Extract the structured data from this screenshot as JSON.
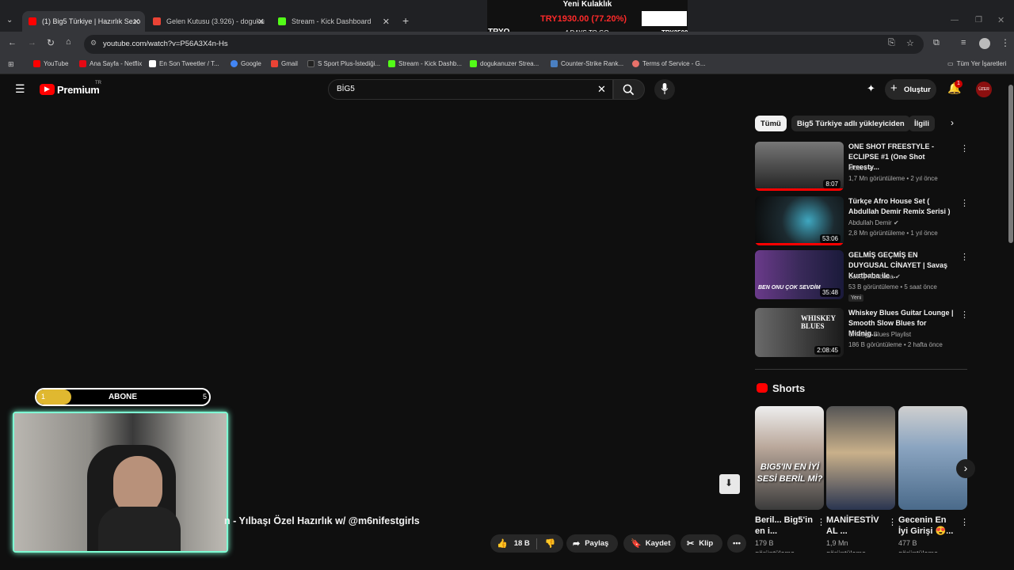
{
  "browser": {
    "tabs": [
      {
        "label": "(1) Big5 Türkiye | Hazırlık Sezonu",
        "favicon_color": "#ff0000",
        "active": true
      },
      {
        "label": "Gelen Kutusu (3.926) - dogukan",
        "favicon_color": "#ea4335",
        "active": false
      },
      {
        "label": "Stream - Kick Dashboard",
        "favicon_color": "#53fc18",
        "active": false
      }
    ],
    "new_tab": "+",
    "url": "youtube.com/watch?v=P56A3X4n-Hs",
    "bookmarks": [
      {
        "label": "YouTube",
        "color": "#ff0000"
      },
      {
        "label": "Ana Sayfa - Netflix",
        "color": "#e50914"
      },
      {
        "label": "En Son Tweetler / T...",
        "color": "#ffffff"
      },
      {
        "label": "Google",
        "color": "#4285f4"
      },
      {
        "label": "Gmail",
        "color": "#ea4335"
      },
      {
        "label": "S Sport Plus-İstediği...",
        "color": "#222222"
      },
      {
        "label": "Stream - Kick Dashb...",
        "color": "#53fc18"
      },
      {
        "label": "dogukanuzer Strea...",
        "color": "#53fc18"
      },
      {
        "label": "Counter-Strike Rank...",
        "color": "#4a7fc1"
      },
      {
        "label": "Terms of Service - G...",
        "color": "#e8716a"
      }
    ],
    "all_bookmarks": "Tüm Yer İşaretleri"
  },
  "overlay": {
    "goal_title": "Yeni Kulaklık",
    "goal_amount": "TRY1930.00 (77.20%)",
    "ticker_left": "TRYO",
    "days_left": "4 DAYS TO GO",
    "goal_target": "TRY2500",
    "sub_bar_label": "ABONE",
    "sub_bar_left": "1",
    "sub_bar_right": "5",
    "sub_progress": 0.2
  },
  "youtube": {
    "logo_text": "Premium",
    "logo_region": "TR",
    "search_value": "BİG5",
    "create_label": "Oluştur",
    "notification_count": "1",
    "avatar_text": "ÜZER",
    "chips": [
      "Tümü",
      "Big5 Türkiye adlı yükleyiciden",
      "İlgili"
    ],
    "video_title": "n - Yılbaşı Özel Hazırlık w/ @m6nifestgirls",
    "actions": {
      "likes": "18 B",
      "share": "Paylaş",
      "save": "Kaydet",
      "clip": "Klip"
    },
    "related": [
      {
        "title": "ONE SHOT FREESTYLE - ECLIPSE #1 (One Shot Freesty...",
        "channel": "Motive",
        "meta": "1,7 Mn görüntüleme • 2 yıl önce",
        "duration": "8:07",
        "badge": "",
        "thumb_color": "#5a5a5a"
      },
      {
        "title": "Türkçe Afro House Set ( Abdullah Demir Remix Serisi )",
        "channel": "Abdullah Demir",
        "meta": "2,8 Mn görüntüleme • 1 yıl önce",
        "duration": "53:06",
        "badge": "",
        "thumb_color": "#1c2a30"
      },
      {
        "title": "GELMİŞ GEÇMİŞ EN DUYGUSAL CİNAYET | Savaş Kurtbaba ile ...",
        "channel": "Savaş Kurtbaba",
        "meta": "53 B görüntüleme • 5 saat önce",
        "duration": "35:48",
        "badge": "Yeni",
        "thumb_color": "#3a2a5a"
      },
      {
        "title": "Whiskey Blues Guitar Lounge | Smooth Slow Blues for Midnig...",
        "channel": "Chicago Blues Playlist",
        "meta": "186 B görüntüleme • 2 hafta önce",
        "duration": "2:08:45",
        "badge": "",
        "thumb_color": "#4a4a4a"
      }
    ],
    "shorts_heading": "Shorts",
    "shorts": [
      {
        "title": "Beril... Big5'in en i...",
        "views": "179 B",
        "views_suffix": "görüntüleme",
        "thumb_color": "#3b3b3b"
      },
      {
        "title": "MANİFESTİV AL ...",
        "views": "1,9 Mn",
        "views_suffix": "görüntüleme",
        "thumb_color": "#2a3550"
      },
      {
        "title": "Gecenin En İyi Girişi 😍...",
        "views": "477 B",
        "views_suffix": "görüntüleme",
        "thumb_color": "#4a6a8a"
      }
    ],
    "thumb_text_3": "BEN ONU ÇOK SEVDİM",
    "thumb_text_4": "WHISKEY BLUES",
    "short_text_1": "BIG5'IN EN İYİ SESİ BERİL Mİ?"
  },
  "colors": {
    "accent": "#ff0000",
    "bg": "#0f0f0f",
    "webcam_border": "#7fffd4"
  }
}
